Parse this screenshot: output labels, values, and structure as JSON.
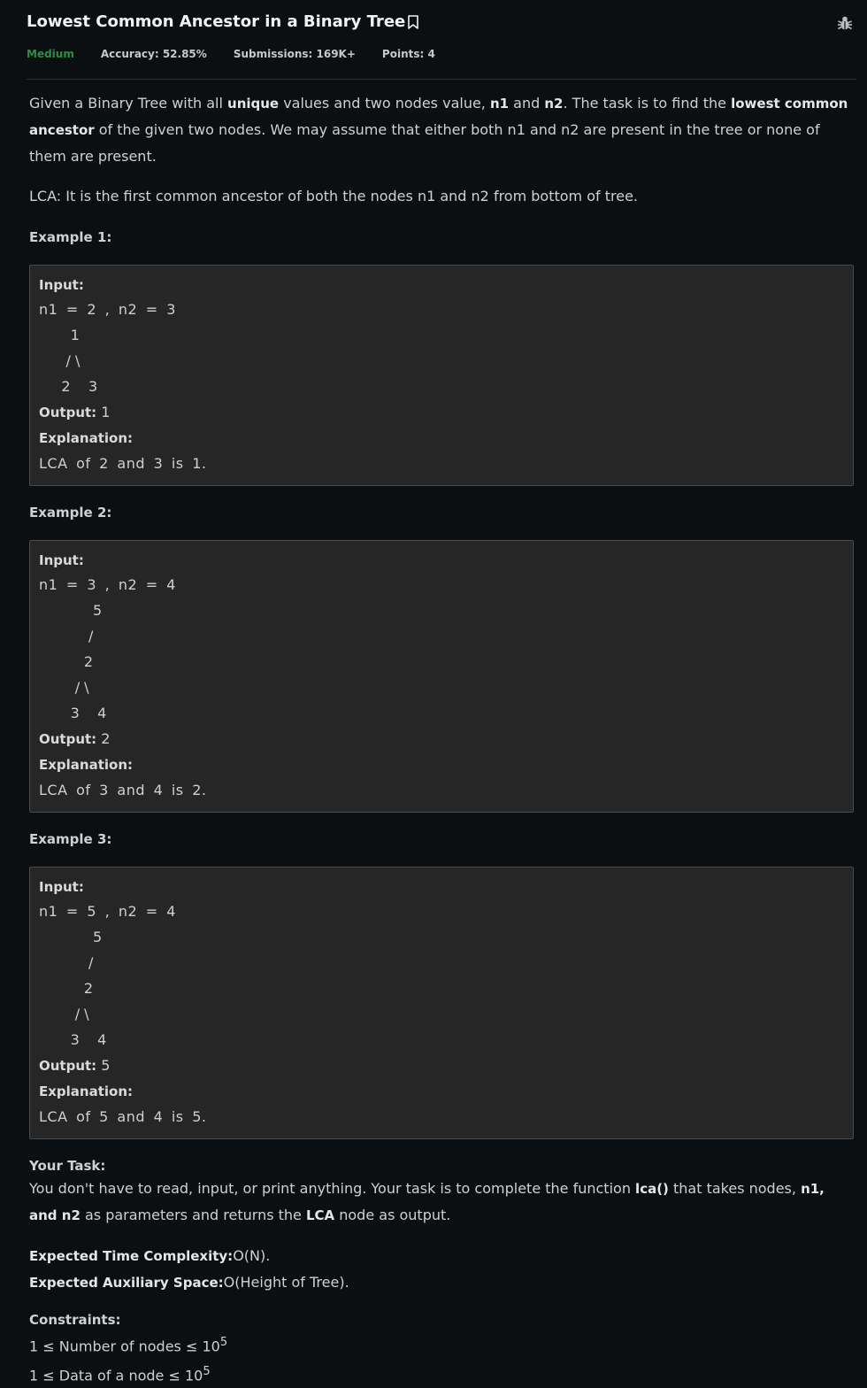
{
  "header": {
    "title": "Lowest Common Ancestor in a Binary Tree",
    "difficulty": "Medium",
    "accuracy": "Accuracy: 52.85%",
    "submissions": "Submissions: 169K+",
    "points": "Points: 4"
  },
  "problem": {
    "intro": {
      "t1": "Given a Binary Tree with all ",
      "b1": "unique",
      "t2": " values and two nodes value, ",
      "b2": "n1",
      "t3": " and ",
      "b3": "n2",
      "t4": ". The task is to find the ",
      "b4": "lowest common ancestor",
      "t5": " of the given two nodes. We may assume that either both n1 and n2 are present in the tree or none of them are present."
    },
    "lca_def": "LCA: It is the first common ancestor of both the nodes n1 and n2 from bottom of tree."
  },
  "examples": [
    {
      "heading": "Example 1:",
      "input_label": "Input:",
      "input": "n1 = 2 , n2 = 3",
      "tree": [
        "       1",
        "      / \\",
        "     2    3"
      ],
      "output_label": "Output:",
      "output": " 1",
      "explanation_label": "Explanation:",
      "explanation": "LCA of 2 and 3 is 1."
    },
    {
      "heading": "Example 2:",
      "input_label": "Input:",
      "input": "n1 = 3 , n2 = 4",
      "tree": [
        "            5",
        "           /",
        "          2",
        "        / \\",
        "       3    4"
      ],
      "output_label": "Output:",
      "output": " 2",
      "explanation_label": "Explanation:",
      "explanation": "LCA of 3 and 4 is 2."
    },
    {
      "heading": "Example 3:",
      "input_label": "Input:",
      "input": "n1 = 5 , n2 = 4",
      "tree": [
        "            5",
        "           /",
        "          2",
        "        / \\",
        "       3    4"
      ],
      "output_label": "Output:",
      "output": " 5",
      "explanation_label": "Explanation:",
      "explanation": "LCA of 5 and 4 is 5."
    }
  ],
  "task": {
    "heading": "Your Task:",
    "t1": "You don't have to read, input, or print anything. Your task is to complete the function ",
    "b1": "lca()",
    "t2": " that takes nodes, ",
    "b2": "n1, and n2",
    "t3": " as parameters and returns the ",
    "b3": "LCA",
    "t4": " node as output."
  },
  "complexity": {
    "time_label": "Expected Time Complexity:",
    "time_value": "O(N).",
    "space_label": "Expected Auxiliary Space:",
    "space_value": "O(Height of Tree)."
  },
  "constraints": {
    "heading": "Constraints:",
    "c1": "1 ≤ Number of nodes ≤ 10",
    "c1_exp": "5",
    "c2": "1 ≤ Data of a node ≤ 10",
    "c2_exp": "5"
  },
  "icons": {
    "bookmark": "bookmark-icon",
    "bug": "bug-icon"
  },
  "colors": {
    "background": "#0c0f11",
    "difficulty": "#2f8d46",
    "example_box": "#262626"
  }
}
